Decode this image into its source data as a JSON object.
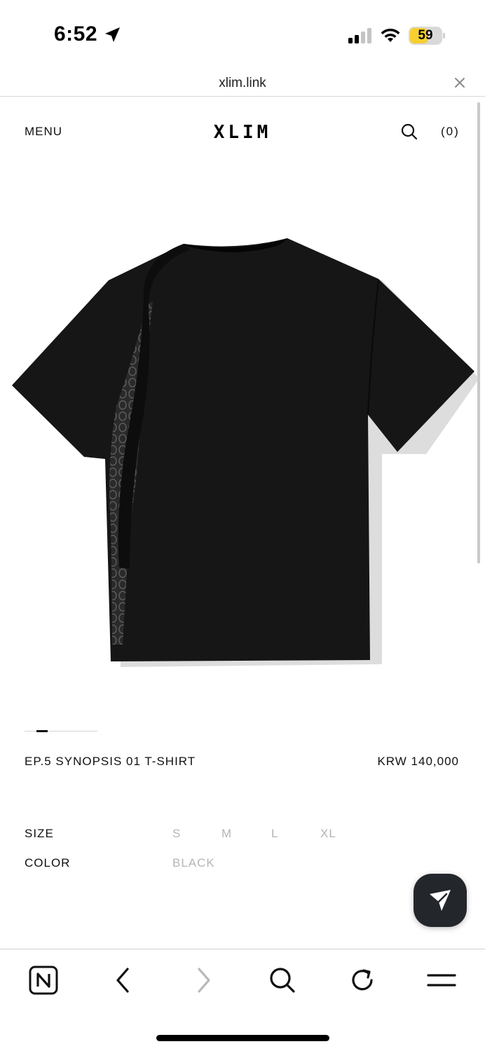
{
  "status_bar": {
    "time": "6:52",
    "battery_level": "59",
    "battery_fraction": 0.59,
    "battery_color": "#f7cf2f"
  },
  "url_bar": {
    "url": "xlim.link",
    "close_icon": "close-icon"
  },
  "header": {
    "menu_label": "MENU",
    "logo": "XLIM",
    "search_icon": "search-icon",
    "cart_count": "(0)"
  },
  "product": {
    "name": "EP.5 SYNOPSIS 01 T-SHIRT",
    "price": "KRW 140,000",
    "gallery_active_index": 1,
    "size_label": "SIZE",
    "sizes": [
      "S",
      "M",
      "L",
      "XL"
    ],
    "color_label": "COLOR",
    "colors": [
      "BLACK"
    ]
  },
  "share_button": {
    "icon": "paper-plane-icon"
  },
  "toolbar": {
    "icons": [
      "naver-home-icon",
      "back-arrow-icon",
      "forward-arrow-icon",
      "search-icon",
      "reload-icon",
      "hamburger-menu-icon"
    ]
  }
}
